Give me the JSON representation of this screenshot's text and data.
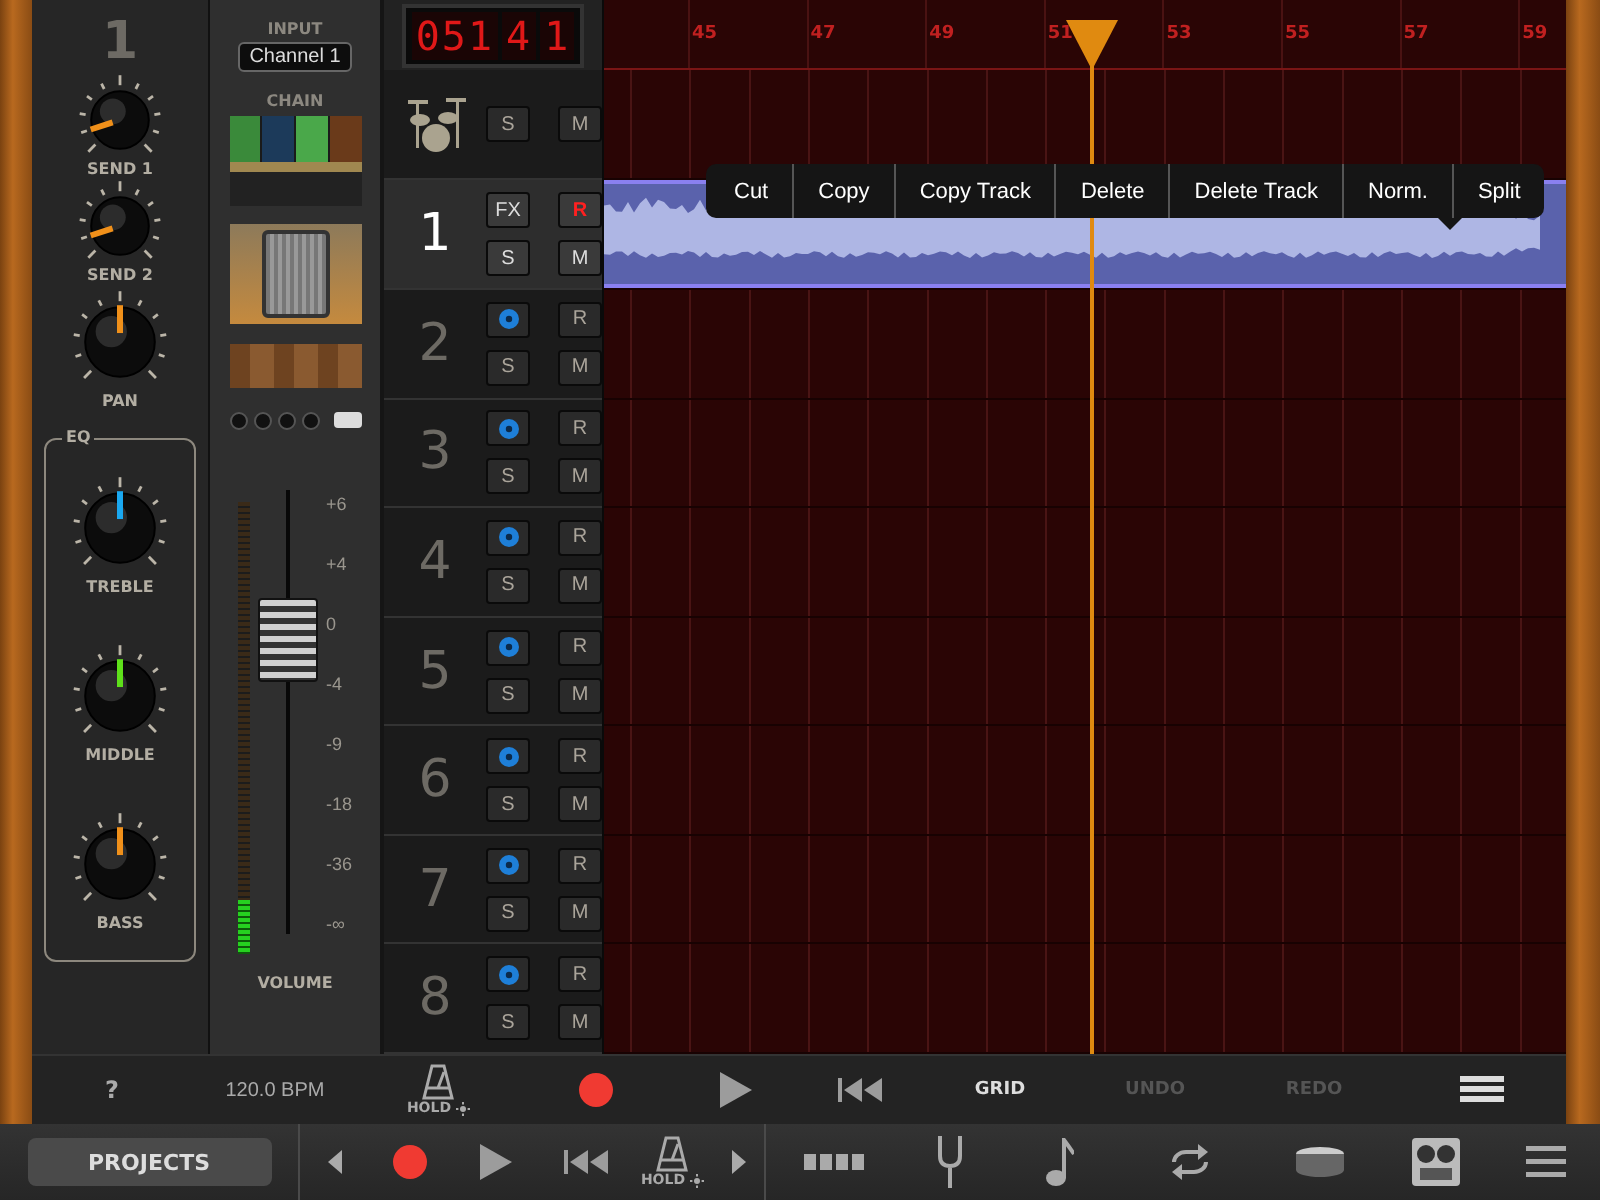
{
  "mixer": {
    "track_number": "1",
    "knobs": [
      {
        "label": "SEND 1",
        "level": 0.1,
        "color": "#f0901a"
      },
      {
        "label": "SEND 2",
        "level": 0.1,
        "color": "#f0901a"
      },
      {
        "label": "PAN",
        "level": 0.5,
        "color": "#f0901a"
      }
    ],
    "eq": {
      "label": "EQ",
      "knobs": [
        {
          "label": "TREBLE",
          "level": 0.5,
          "color": "#1aa8f0"
        },
        {
          "label": "MIDDLE",
          "level": 0.5,
          "color": "#5ee01a"
        },
        {
          "label": "BASS",
          "level": 0.5,
          "color": "#f0901a"
        }
      ]
    }
  },
  "chain": {
    "input_label": "INPUT",
    "input_value": "Channel 1",
    "chain_label": "CHAIN"
  },
  "volume": {
    "scale": [
      "+6",
      "+4",
      "0",
      "-4",
      "-9",
      "-18",
      "-36",
      "-∞"
    ],
    "level": 0.7,
    "meter": {
      "level": 0.12
    },
    "label": "VOLUME"
  },
  "counter": [
    "051",
    "4",
    "1"
  ],
  "tracks": [
    {
      "kind": "drums",
      "selected": false,
      "has_region": false,
      "buttons": [
        {
          "kind": "solo",
          "label": "S",
          "on": false
        },
        {
          "kind": "mute",
          "label": "M",
          "on": false
        }
      ]
    },
    {
      "kind": "audio",
      "number": "1",
      "selected": true,
      "has_region": true,
      "buttons": [
        {
          "kind": "fx",
          "label": "FX"
        },
        {
          "kind": "record",
          "label": "R",
          "on": true
        },
        {
          "kind": "solo",
          "label": "S",
          "on": false
        },
        {
          "kind": "mute",
          "label": "M",
          "on": false
        }
      ]
    },
    {
      "kind": "audio",
      "number": "2",
      "selected": false,
      "has_region": false,
      "buttons": [
        {
          "kind": "monitor"
        },
        {
          "kind": "record",
          "label": "R",
          "on": false
        },
        {
          "kind": "solo",
          "label": "S",
          "on": false
        },
        {
          "kind": "mute",
          "label": "M",
          "on": false
        }
      ]
    },
    {
      "kind": "audio",
      "number": "3",
      "selected": false,
      "has_region": false,
      "buttons": [
        {
          "kind": "monitor"
        },
        {
          "kind": "record",
          "label": "R",
          "on": false
        },
        {
          "kind": "solo",
          "label": "S",
          "on": false
        },
        {
          "kind": "mute",
          "label": "M",
          "on": false
        }
      ]
    },
    {
      "kind": "audio",
      "number": "4",
      "selected": false,
      "has_region": false,
      "buttons": [
        {
          "kind": "monitor"
        },
        {
          "kind": "record",
          "label": "R",
          "on": false
        },
        {
          "kind": "solo",
          "label": "S",
          "on": false
        },
        {
          "kind": "mute",
          "label": "M",
          "on": false
        }
      ]
    },
    {
      "kind": "audio",
      "number": "5",
      "selected": false,
      "has_region": false,
      "buttons": [
        {
          "kind": "monitor"
        },
        {
          "kind": "record",
          "label": "R",
          "on": false
        },
        {
          "kind": "solo",
          "label": "S",
          "on": false
        },
        {
          "kind": "mute",
          "label": "M",
          "on": false
        }
      ]
    },
    {
      "kind": "audio",
      "number": "6",
      "selected": false,
      "has_region": false,
      "buttons": [
        {
          "kind": "monitor"
        },
        {
          "kind": "record",
          "label": "R",
          "on": false
        },
        {
          "kind": "solo",
          "label": "S",
          "on": false
        },
        {
          "kind": "mute",
          "label": "M",
          "on": false
        }
      ]
    },
    {
      "kind": "audio",
      "number": "7",
      "selected": false,
      "has_region": false,
      "buttons": [
        {
          "kind": "monitor"
        },
        {
          "kind": "record",
          "label": "R",
          "on": false
        },
        {
          "kind": "solo",
          "label": "S",
          "on": false
        },
        {
          "kind": "mute",
          "label": "M",
          "on": false
        }
      ]
    },
    {
      "kind": "audio",
      "number": "8",
      "selected": false,
      "has_region": false,
      "buttons": [
        {
          "kind": "monitor"
        },
        {
          "kind": "record",
          "label": "R",
          "on": false
        },
        {
          "kind": "solo",
          "label": "S",
          "on": false
        },
        {
          "kind": "mute",
          "label": "M",
          "on": false
        }
      ]
    }
  ],
  "ruler": [
    "45",
    "47",
    "49",
    "51",
    "53",
    "55",
    "57",
    "59"
  ],
  "context_menu": [
    "Cut",
    "Copy",
    "Copy Track",
    "Delete",
    "Delete Track",
    "Norm.",
    "Split"
  ],
  "transport": [
    {
      "kind": "help",
      "label": "?"
    },
    {
      "kind": "tempo",
      "label": "120.0 BPM"
    },
    {
      "kind": "metronome",
      "label": "HOLD"
    },
    {
      "kind": "record"
    },
    {
      "kind": "play"
    },
    {
      "kind": "rewind"
    },
    {
      "kind": "text",
      "label": "GRID",
      "disabled": false
    },
    {
      "kind": "text",
      "label": "UNDO",
      "disabled": true
    },
    {
      "kind": "text",
      "label": "REDO",
      "disabled": true
    },
    {
      "kind": "lanes"
    }
  ],
  "dock": [
    {
      "kind": "button",
      "label": "PROJECTS"
    },
    {
      "kind": "prev"
    },
    {
      "kind": "record"
    },
    {
      "kind": "play"
    },
    {
      "kind": "rewind"
    },
    {
      "kind": "metronome",
      "label": "HOLD"
    },
    {
      "kind": "next"
    },
    {
      "kind": "pattern"
    },
    {
      "kind": "tuner"
    },
    {
      "kind": "note"
    },
    {
      "kind": "loop"
    },
    {
      "kind": "drum"
    },
    {
      "kind": "tape"
    },
    {
      "kind": "menu"
    }
  ]
}
